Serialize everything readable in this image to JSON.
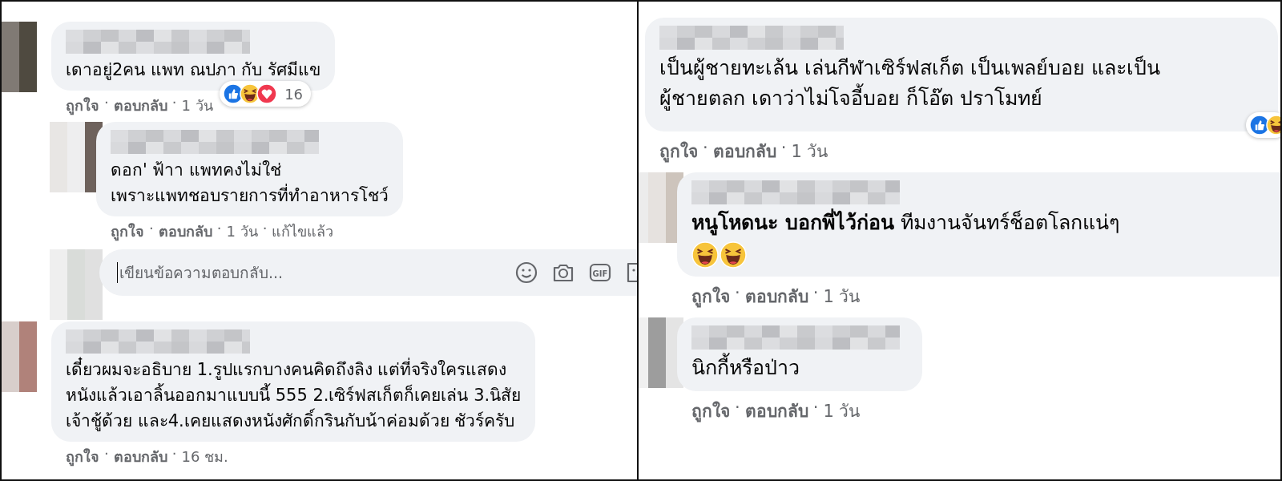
{
  "separator": "·",
  "panels": [
    {
      "comments": [
        {
          "avatar": true,
          "text": "เดาอยู่2คน แพท ณปภา กับ รัศมีแข",
          "reactions": [
            {
              "kind": "like"
            },
            {
              "kind": "haha"
            },
            {
              "kind": "love"
            }
          ],
          "reaction_count": "16",
          "actions": [
            {
              "link": true,
              "label": "ถูกใจ"
            },
            {
              "link": true,
              "label": "ตอบกลับ"
            },
            {
              "link": false,
              "label": "1 วัน"
            }
          ],
          "replies": [
            {
              "kind": "comment",
              "avatar": true,
              "text": "ดอก' ฟ้าา แพทคงไม่ใช่\nเพราะแพทชอบรายการที่ทำอาหารโชว์",
              "actions": [
                {
                  "link": true,
                  "label": "ถูกใจ"
                },
                {
                  "link": true,
                  "label": "ตอบกลับ"
                },
                {
                  "link": false,
                  "label": "1 วัน"
                },
                {
                  "link": false,
                  "label": "แก้ไขแล้ว"
                }
              ]
            },
            {
              "kind": "reply_box",
              "placeholder": "เขียนข้อความตอบกลับ...",
              "tools": [
                {
                  "kind": "emoji"
                },
                {
                  "kind": "camera"
                },
                {
                  "kind": "gif",
                  "label": "GIF"
                },
                {
                  "kind": "sticker"
                }
              ]
            }
          ]
        },
        {
          "avatar": true,
          "text": "เดี๋ยวผมจะอธิบาย 1.รูปแรกบางคนคิดถึงลิง แต่ที่จริงใครแสดง\nหนังแล้วเอาลิ้นออกมาแบบนี้ 555 2.เซิร์ฟสเก็ตก็เคยเล่น 3.นิสัย\nเจ้าชู้ด้วย และ4.เคยแสดงหนังศักดิ์กรินกับน้าค่อมด้วย ชัวร์ครับ",
          "actions": [
            {
              "link": true,
              "label": "ถูกใจ"
            },
            {
              "link": true,
              "label": "ตอบกลับ"
            },
            {
              "link": false,
              "label": "16 ชม."
            }
          ]
        }
      ]
    },
    {
      "comments": [
        {
          "avatar": false,
          "text": "เป็นผู้ชายทะเล้น เล่นกีฬาเซิร์ฟสเก็ต เป็นเพลย์บอย และเป็น\nผู้ชายตลก เดาว่าไม่โจอี้บอย ก็โอ๊ต ปราโมทย์",
          "reactions": [
            {
              "kind": "like"
            },
            {
              "kind": "haha"
            }
          ],
          "actions": [
            {
              "link": true,
              "label": "ถูกใจ"
            },
            {
              "link": true,
              "label": "ตอบกลับ"
            },
            {
              "link": false,
              "label": "1 วัน"
            }
          ],
          "replies": [
            {
              "kind": "comment",
              "avatar": true,
              "text": "**หนูโหดนะ บอกพี่ไว้ก่อน** ทีมงานจันทร์ช็อตโลกแน่ๆ",
              "emojis": [
                {
                  "kind": "haha"
                },
                {
                  "kind": "haha"
                }
              ],
              "actions": [
                {
                  "link": true,
                  "label": "ถูกใจ"
                },
                {
                  "link": true,
                  "label": "ตอบกลับ"
                },
                {
                  "link": false,
                  "label": "1 วัน"
                }
              ]
            },
            {
              "kind": "comment",
              "avatar": true,
              "text": "นิกกี้หรือป่าว",
              "actions": [
                {
                  "link": true,
                  "label": "ถูกใจ"
                },
                {
                  "link": true,
                  "label": "ตอบกลับ"
                },
                {
                  "link": false,
                  "label": "1 วัน"
                }
              ]
            }
          ]
        }
      ]
    }
  ]
}
